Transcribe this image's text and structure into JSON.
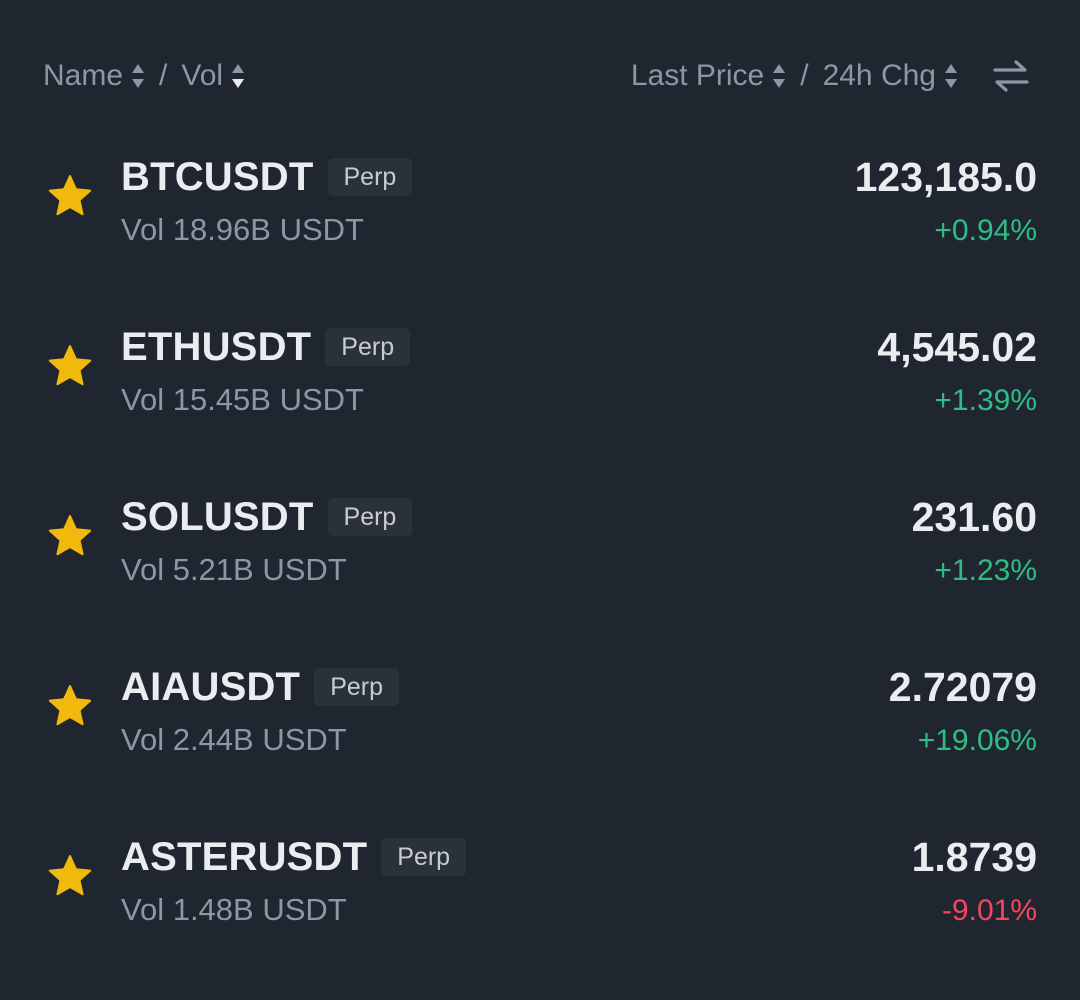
{
  "header": {
    "name_label": "Name",
    "vol_label": "Vol",
    "separator": "/",
    "last_price_label": "Last Price",
    "chg_label": "24h Chg"
  },
  "colors": {
    "background": "#202630",
    "up": "#2ebd85",
    "down": "#f6465d",
    "star": "#f0b90b"
  },
  "rows": [
    {
      "symbol": "BTCUSDT",
      "badge": "Perp",
      "vol": "Vol 18.96B USDT",
      "price": "123,185.0",
      "change": "+0.94%",
      "direction": "up",
      "favorite": true
    },
    {
      "symbol": "ETHUSDT",
      "badge": "Perp",
      "vol": "Vol 15.45B USDT",
      "price": "4,545.02",
      "change": "+1.39%",
      "direction": "up",
      "favorite": true
    },
    {
      "symbol": "SOLUSDT",
      "badge": "Perp",
      "vol": "Vol 5.21B USDT",
      "price": "231.60",
      "change": "+1.23%",
      "direction": "up",
      "favorite": true
    },
    {
      "symbol": "AIAUSDT",
      "badge": "Perp",
      "vol": "Vol 2.44B USDT",
      "price": "2.72079",
      "change": "+19.06%",
      "direction": "up",
      "favorite": true
    },
    {
      "symbol": "ASTERUSDT",
      "badge": "Perp",
      "vol": "Vol 1.48B USDT",
      "price": "1.8739",
      "change": "-9.01%",
      "direction": "down",
      "favorite": true
    }
  ]
}
